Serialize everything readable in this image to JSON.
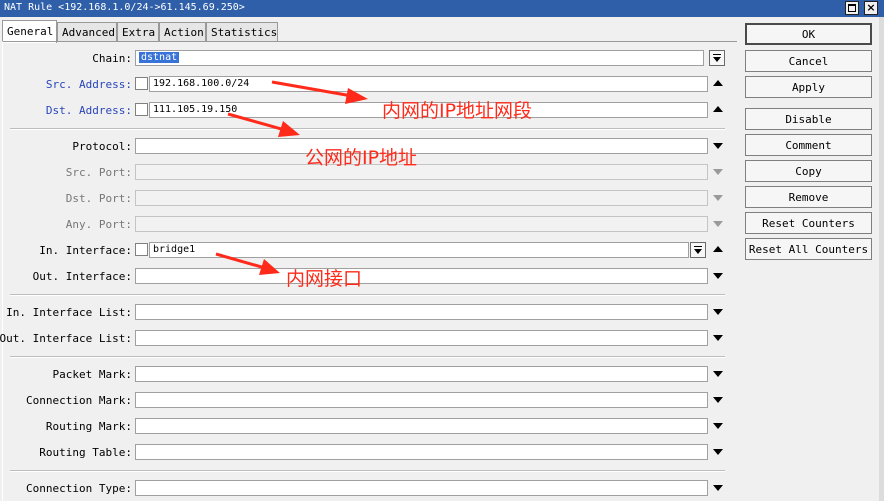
{
  "window": {
    "title": "NAT Rule <192.168.1.0/24->61.145.69.250>",
    "buttons": [
      "restore-icon",
      "close-icon"
    ]
  },
  "tabs": [
    "General",
    "Advanced",
    "Extra",
    "Action",
    "Statistics"
  ],
  "active_tab": "General",
  "fields": {
    "chain": {
      "label": "Chain:",
      "value": "dstnat"
    },
    "src_address": {
      "label": "Src. Address:",
      "value": "192.168.100.0/24"
    },
    "dst_address": {
      "label": "Dst. Address:",
      "value": "111.105.19.150"
    },
    "protocol": {
      "label": "Protocol:",
      "value": ""
    },
    "src_port": {
      "label": "Src. Port:",
      "value": ""
    },
    "dst_port": {
      "label": "Dst. Port:",
      "value": ""
    },
    "any_port": {
      "label": "Any. Port:",
      "value": ""
    },
    "in_interface": {
      "label": "In. Interface:",
      "value": "bridge1"
    },
    "out_interface": {
      "label": "Out. Interface:",
      "value": ""
    },
    "in_interface_list": {
      "label": "In. Interface List:",
      "value": ""
    },
    "out_interface_list": {
      "label": "Out. Interface List:",
      "value": ""
    },
    "packet_mark": {
      "label": "Packet Mark:",
      "value": ""
    },
    "connection_mark": {
      "label": "Connection Mark:",
      "value": ""
    },
    "routing_mark": {
      "label": "Routing Mark:",
      "value": ""
    },
    "routing_table": {
      "label": "Routing Table:",
      "value": ""
    },
    "connection_type": {
      "label": "Connection Type:",
      "value": ""
    }
  },
  "buttons": {
    "ok": "OK",
    "cancel": "Cancel",
    "apply": "Apply",
    "disable": "Disable",
    "comment": "Comment",
    "copy": "Copy",
    "remove": "Remove",
    "reset_counters": "Reset Counters",
    "reset_all_counters": "Reset All Counters"
  },
  "annotations": {
    "src_note": "内网的IP地址网段",
    "dst_note": "公网的IP地址",
    "iface_note": "内网接口",
    "color": "#ff2a1a"
  },
  "colors": {
    "titlebar": "#2f5fa9",
    "label_link": "#2a45b8",
    "selection": "#3873d8"
  }
}
